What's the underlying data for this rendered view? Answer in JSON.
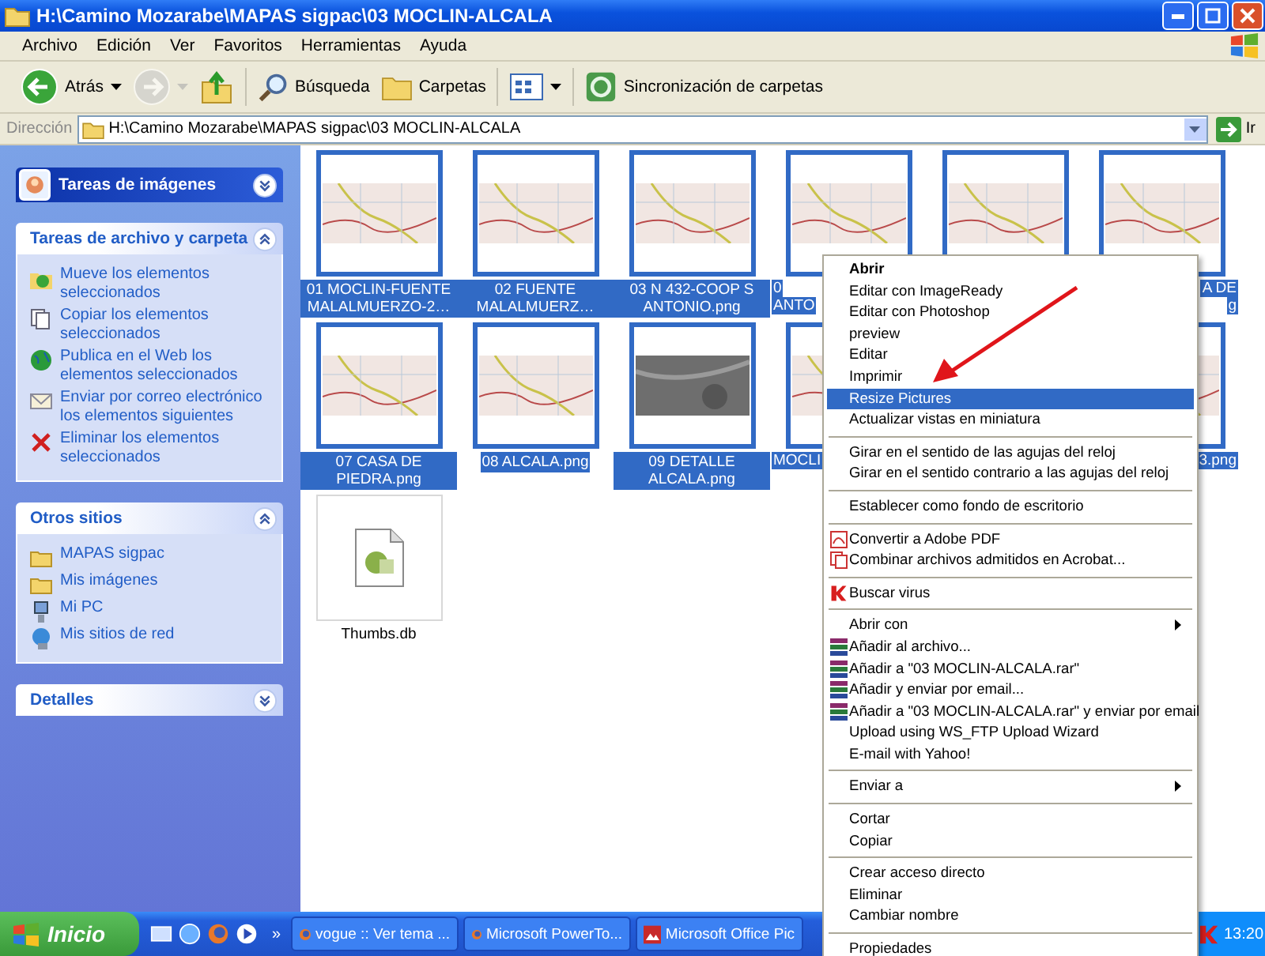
{
  "window": {
    "title": "H:\\Camino Mozarabe\\MAPAS sigpac\\03 MOCLIN-ALCALA"
  },
  "menubar": [
    "Archivo",
    "Edición",
    "Ver",
    "Favoritos",
    "Herramientas",
    "Ayuda"
  ],
  "toolbar": {
    "buttons": [
      {
        "kind": "back",
        "label": "Atrás",
        "disabled": false
      },
      {
        "kind": "forward",
        "disabled": true
      },
      {
        "kind": "up",
        "disabled": false
      },
      {
        "kind": "search",
        "label": "Búsqueda",
        "disabled": false
      },
      {
        "kind": "folders",
        "label": "Carpetas",
        "disabled": false
      },
      {
        "kind": "views",
        "disabled": false
      },
      {
        "kind": "sync",
        "label": "Sincronización de carpetas",
        "disabled": false
      }
    ]
  },
  "address": {
    "label": "Dirección",
    "value": "H:\\Camino Mozarabe\\MAPAS sigpac\\03 MOCLIN-ALCALA",
    "go": "Ir"
  },
  "sidebar": {
    "sections": [
      {
        "title": "Tareas de imágenes",
        "kind": "special",
        "expanded": false
      },
      {
        "title": "Tareas de archivo y carpeta",
        "kind": "normal",
        "expanded": true,
        "items": [
          {
            "label": "Mueve los elementos seleccionados",
            "kind": "move"
          },
          {
            "label": "Copiar los elementos seleccionados",
            "kind": "copy"
          },
          {
            "label": "Publica en el Web los elementos seleccionados",
            "kind": "web"
          },
          {
            "label": "Enviar por correo electrónico los elementos siguientes",
            "kind": "email"
          },
          {
            "label": "Eliminar los elementos seleccionados",
            "kind": "delete"
          }
        ]
      },
      {
        "title": "Otros sitios",
        "kind": "normal",
        "expanded": true,
        "items": [
          {
            "label": "MAPAS sigpac",
            "kind": "folder"
          },
          {
            "label": "Mis imágenes",
            "kind": "folder"
          },
          {
            "label": "Mi PC",
            "kind": "computer"
          },
          {
            "label": "Mis sitios de red",
            "kind": "network"
          }
        ]
      },
      {
        "title": "Detalles",
        "kind": "normal",
        "expanded": false
      }
    ]
  },
  "files": [
    {
      "kind": "map",
      "selected": true,
      "label": {
        "kind": "full",
        "text": "01 MOCLIN-FUENTE MALALMUERZO-2…"
      }
    },
    {
      "kind": "map",
      "selected": true,
      "label": {
        "kind": "full",
        "text": "02 FUENTE MALALMUERZ…"
      }
    },
    {
      "kind": "map",
      "selected": true,
      "label": {
        "kind": "full",
        "text": "03 N 432-COOP S ANTONIO.png"
      }
    },
    {
      "kind": "map",
      "selected": true,
      "label": {
        "kind": "cut_right",
        "lines": [
          "0",
          "ANTO"
        ]
      }
    },
    {
      "kind": "map",
      "selected": true
    },
    {
      "kind": "map",
      "selected": true,
      "label": {
        "kind": "cut_left",
        "lines": [
          "A DE",
          "g"
        ]
      }
    },
    {
      "kind": "map",
      "selected": true,
      "label": {
        "kind": "full",
        "text": "07 CASA DE PIEDRA.png"
      }
    },
    {
      "kind": "map",
      "selected": true,
      "label": {
        "kind": "full",
        "text": "08 ALCALA.png"
      }
    },
    {
      "kind": "aerial",
      "selected": true,
      "label": {
        "kind": "full",
        "text": "09 DETALLE ALCALA.png"
      }
    },
    {
      "kind": "map",
      "selected": true,
      "label": {
        "kind": "cut_right",
        "lines": [
          "MOCLI"
        ]
      }
    },
    {
      "kind": "covered"
    },
    {
      "kind": "map",
      "selected": true,
      "label": {
        "kind": "cut_left",
        "lines": [
          "3.png"
        ]
      }
    },
    {
      "kind": "file",
      "selected": false,
      "label": {
        "kind": "full",
        "text": "Thumbs.db"
      }
    }
  ],
  "context_menu": {
    "groups": [
      [
        {
          "label": "Abrir",
          "kind": "plain",
          "default": true,
          "selected": false,
          "submenu": false
        },
        {
          "label": "Editar con ImageReady",
          "kind": "plain",
          "default": false,
          "selected": false,
          "submenu": false
        },
        {
          "label": "Editar con Photoshop",
          "kind": "plain",
          "default": false,
          "selected": false,
          "submenu": false
        },
        {
          "label": "preview",
          "kind": "plain",
          "default": false,
          "selected": false,
          "submenu": false
        },
        {
          "label": "Editar",
          "kind": "plain",
          "default": false,
          "selected": false,
          "submenu": false
        },
        {
          "label": "Imprimir",
          "kind": "plain",
          "default": false,
          "selected": false,
          "submenu": false
        },
        {
          "label": "Resize Pictures",
          "kind": "plain",
          "default": false,
          "selected": true,
          "submenu": false
        },
        {
          "label": "Actualizar vistas en miniatura",
          "kind": "plain",
          "default": false,
          "selected": false,
          "submenu": false
        }
      ],
      [
        {
          "label": "Girar en el sentido de las agujas del reloj",
          "kind": "plain",
          "default": false,
          "selected": false,
          "submenu": false
        },
        {
          "label": "Girar en el sentido contrario a las agujas del reloj",
          "kind": "plain",
          "default": false,
          "selected": false,
          "submenu": false
        }
      ],
      [
        {
          "label": "Establecer como fondo de escritorio",
          "kind": "plain",
          "default": false,
          "selected": false,
          "submenu": false
        }
      ],
      [
        {
          "label": "Convertir a Adobe PDF",
          "kind": "pdf",
          "default": false,
          "selected": false,
          "submenu": false
        },
        {
          "label": "Combinar archivos admitidos en Acrobat...",
          "kind": "acrobat",
          "default": false,
          "selected": false,
          "submenu": false
        }
      ],
      [
        {
          "label": "Buscar virus",
          "kind": "antivirus",
          "default": false,
          "selected": false,
          "submenu": false
        }
      ],
      [
        {
          "label": "Abrir con",
          "kind": "plain",
          "default": false,
          "selected": false,
          "submenu": true
        },
        {
          "label": "Añadir al archivo...",
          "kind": "archive",
          "default": false,
          "selected": false,
          "submenu": false
        },
        {
          "label": "Añadir a \"03 MOCLIN-ALCALA.rar\"",
          "kind": "archive",
          "default": false,
          "selected": false,
          "submenu": false
        },
        {
          "label": "Añadir y enviar por email...",
          "kind": "archive",
          "default": false,
          "selected": false,
          "submenu": false
        },
        {
          "label": "Añadir a \"03 MOCLIN-ALCALA.rar\" y enviar por email",
          "kind": "archive",
          "default": false,
          "selected": false,
          "submenu": false
        },
        {
          "label": "Upload using WS_FTP Upload Wizard",
          "kind": "plain",
          "default": false,
          "selected": false,
          "submenu": false
        },
        {
          "label": "E-mail with Yahoo!",
          "kind": "plain",
          "default": false,
          "selected": false,
          "submenu": false
        }
      ],
      [
        {
          "label": "Enviar a",
          "kind": "plain",
          "default": false,
          "selected": false,
          "submenu": true
        }
      ],
      [
        {
          "label": "Cortar",
          "kind": "plain",
          "default": false,
          "selected": false,
          "submenu": false
        },
        {
          "label": "Copiar",
          "kind": "plain",
          "default": false,
          "selected": false,
          "submenu": false
        }
      ],
      [
        {
          "label": "Crear acceso directo",
          "kind": "plain",
          "default": false,
          "selected": false,
          "submenu": false
        },
        {
          "label": "Eliminar",
          "kind": "plain",
          "default": false,
          "selected": false,
          "submenu": false
        },
        {
          "label": "Cambiar nombre",
          "kind": "plain",
          "default": false,
          "selected": false,
          "submenu": false
        }
      ],
      [
        {
          "label": "Propiedades",
          "kind": "plain",
          "default": false,
          "selected": false,
          "submenu": false
        }
      ]
    ]
  },
  "taskbar": {
    "start": "Inicio",
    "overflow": "»",
    "tasks": [
      {
        "label": "vogue :: Ver tema ...",
        "kind": "browser"
      },
      {
        "label": "Microsoft PowerTo...",
        "kind": "browser"
      },
      {
        "label": "Microsoft Office Pic",
        "kind": "picture"
      }
    ],
    "clock": "13:20"
  }
}
